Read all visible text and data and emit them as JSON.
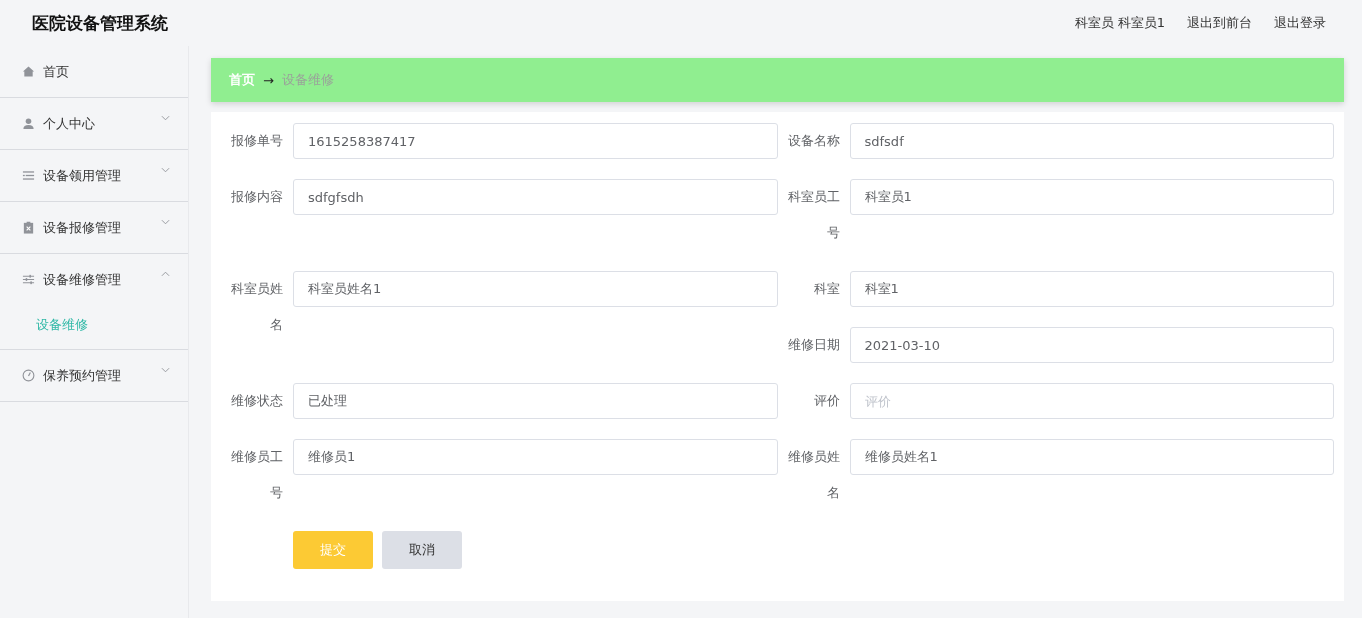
{
  "header": {
    "title": "医院设备管理系统",
    "user_role": "科室员",
    "user_name": "科室员1",
    "links": [
      "退出到前台",
      "退出登录"
    ]
  },
  "sidebar": {
    "items": [
      {
        "kind": "link",
        "label": "首页"
      },
      {
        "kind": "submenu",
        "label": "个人中心",
        "expanded": false
      },
      {
        "kind": "submenu",
        "label": "设备领用管理",
        "expanded": false
      },
      {
        "kind": "submenu",
        "label": "设备报修管理",
        "expanded": false
      },
      {
        "kind": "submenu",
        "label": "设备维修管理",
        "expanded": true,
        "children": [
          {
            "label": "设备维修",
            "selected": true
          }
        ]
      },
      {
        "kind": "submenu",
        "label": "保养预约管理",
        "expanded": false
      }
    ]
  },
  "breadcrumb": {
    "home": "首页",
    "separator": "→",
    "current": "设备维修"
  },
  "form": {
    "fields": [
      {
        "label": "报修单号",
        "value": "1615258387417"
      },
      {
        "label": "设备名称",
        "value": "sdfsdf"
      },
      {
        "label": "报修内容",
        "value": "sdfgfsdh"
      },
      {
        "label": "科室员工号",
        "value": "科室员1"
      },
      {
        "label": "科室员姓名",
        "value": "科室员姓名1"
      },
      {
        "label": "科室",
        "value": "科室1"
      },
      {
        "label": "维修日期",
        "value": "2021-03-10"
      },
      {
        "label": "维修状态",
        "value": "已处理"
      },
      {
        "label": "评价",
        "placeholder": "评价"
      },
      {
        "label": "维修员工号",
        "value": "维修员1"
      },
      {
        "label": "维修员姓名",
        "value": "维修员姓名1"
      }
    ],
    "buttons": [
      {
        "kind": "primary",
        "label": "提交"
      },
      {
        "kind": "secondary",
        "label": "取消"
      }
    ]
  }
}
